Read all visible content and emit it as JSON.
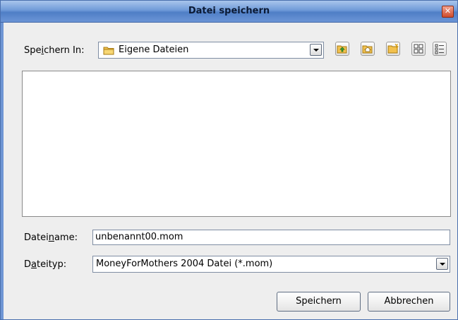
{
  "window": {
    "title": "Datei speichern",
    "close_symbol": "✕"
  },
  "save_in": {
    "label_pre": "Spe",
    "label_mnemonic": "i",
    "label_post": "chern In:",
    "value": "Eigene Dateien",
    "icon": "folder-icon"
  },
  "toolbar": {
    "buttons": [
      {
        "name": "up-one-level-icon"
      },
      {
        "name": "home-icon"
      },
      {
        "name": "new-folder-icon"
      },
      {
        "name": "list-view-icon"
      },
      {
        "name": "details-view-icon"
      }
    ]
  },
  "filename": {
    "label_pre": "Datei",
    "label_mnemonic": "n",
    "label_post": "ame:",
    "value": "unbenannt00.mom"
  },
  "filetype": {
    "label_pre": "D",
    "label_mnemonic": "a",
    "label_post": "teityp:",
    "value": "MoneyForMothers 2004 Datei (*.mom)"
  },
  "buttons": {
    "save": "Speichern",
    "cancel": "Abbrechen"
  },
  "colors": {
    "title_bar": "#6f9ad8",
    "dialog_bg": "#eeeeee",
    "close_button": "#cf4b2b",
    "folder": "#f2c14e"
  }
}
